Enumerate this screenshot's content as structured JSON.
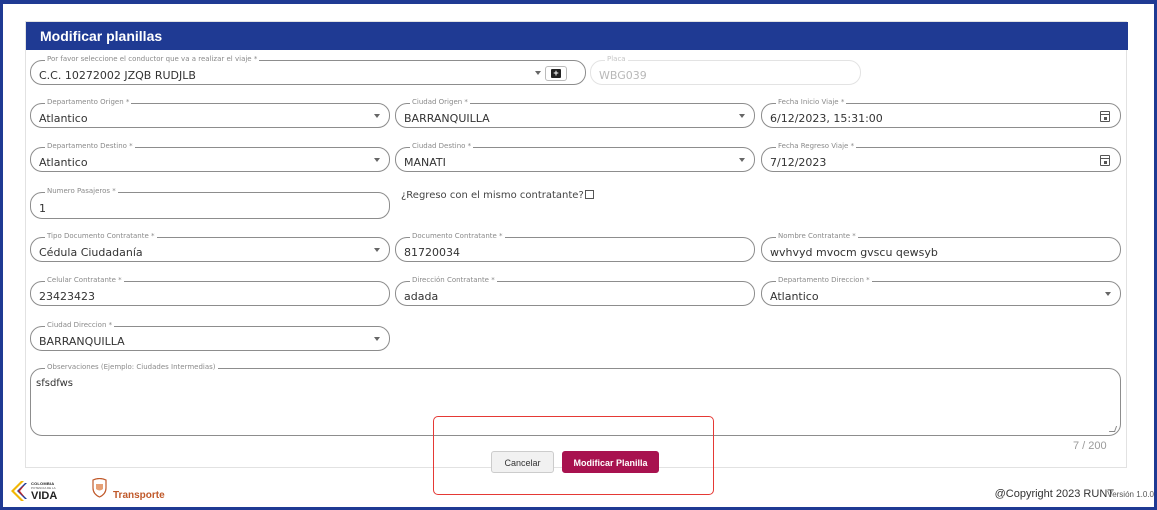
{
  "header": {
    "title": "Modificar planillas"
  },
  "colors": {
    "header_bg": "#1f3a93",
    "primary_button": "#a8124f",
    "highlight_border": "#e53935"
  },
  "form": {
    "conductor": {
      "label": "Por favor seleccione el conductor que va a realizar el viaje *",
      "value": "C.C. 10272002 JZQB RUDJLB"
    },
    "placa": {
      "label": "Placa",
      "value": "WBG039"
    },
    "departamento_origen": {
      "label": "Departamento Origen *",
      "value": "Atlantico"
    },
    "ciudad_origen": {
      "label": "Ciudad Origen *",
      "value": "BARRANQUILLA"
    },
    "fecha_inicio": {
      "label": "Fecha Inicio Viaje *",
      "value": "6/12/2023, 15:31:00"
    },
    "departamento_destino": {
      "label": "Departamento Destino *",
      "value": "Atlantico"
    },
    "ciudad_destino": {
      "label": "Ciudad Destino *",
      "value": "MANATI"
    },
    "fecha_regreso": {
      "label": "Fecha Regreso Viaje *",
      "value": "7/12/2023"
    },
    "numero_pasajeros": {
      "label": "Numero Pasajeros *",
      "value": "1"
    },
    "regreso_mismo_contratante": {
      "label": "¿Regreso con el mismo contratante?",
      "checked": false
    },
    "tipo_documento": {
      "label": "Tipo Documento Contratante *",
      "value": "Cédula Ciudadanía"
    },
    "documento_contratante": {
      "label": "Documento Contratante *",
      "value": "81720034"
    },
    "nombre_contratante": {
      "label": "Nombre Contratante *",
      "value": "wvhvyd mvocm gvscu qewsyb"
    },
    "celular_contratante": {
      "label": "Celular Contratante *",
      "value": "23423423"
    },
    "direccion_contratante": {
      "label": "Dirección Contratante *",
      "value": "adada"
    },
    "departamento_direccion": {
      "label": "Departamento Direccion *",
      "value": "Atlantico"
    },
    "ciudad_direccion": {
      "label": "Ciudad Direccion *",
      "value": "BARRANQUILLA"
    },
    "observaciones": {
      "label": "Observaciones (Ejemplo: Ciudades Intermedias)",
      "value": "sfsdfws",
      "counter": "7 / 200"
    }
  },
  "actions": {
    "cancel_label": "Cancelar",
    "submit_label": "Modificar Planilla"
  },
  "footer": {
    "colombia_line1": "COLOMBIA",
    "colombia_line2": "POTENCIA DE LA",
    "colombia_line3": "VIDA",
    "transporte": "Transporte",
    "copyright": "@Copyright 2023 RUNT",
    "version": "Versión 1.0.0"
  }
}
